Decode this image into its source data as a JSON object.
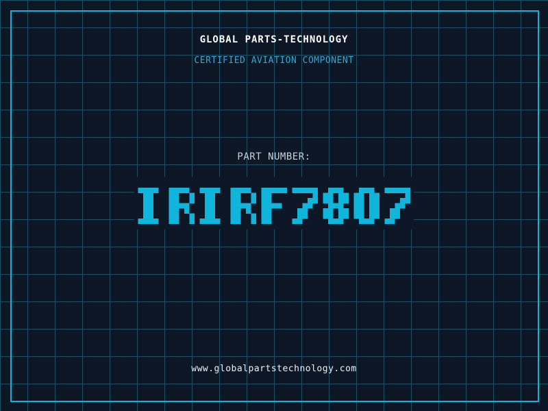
{
  "colors": {
    "background": "#0e1726",
    "grid-line": "#1d4f63",
    "frame": "#0fb4da",
    "title-text": "#ffffff",
    "tagline-text": "#2fa9d6",
    "part-label-text": "#c9d2d9",
    "part-number-text": "#10b5dc",
    "footer-text": "#edf1f4"
  },
  "header": {
    "title": "GLOBAL PARTS-TECHNOLOGY",
    "subtitle": "CERTIFIED AVIATION COMPONENT"
  },
  "part": {
    "label": "PART NUMBER:",
    "number": "IRIRF7807"
  },
  "footer": {
    "website": "www.globalpartstechnology.com"
  }
}
